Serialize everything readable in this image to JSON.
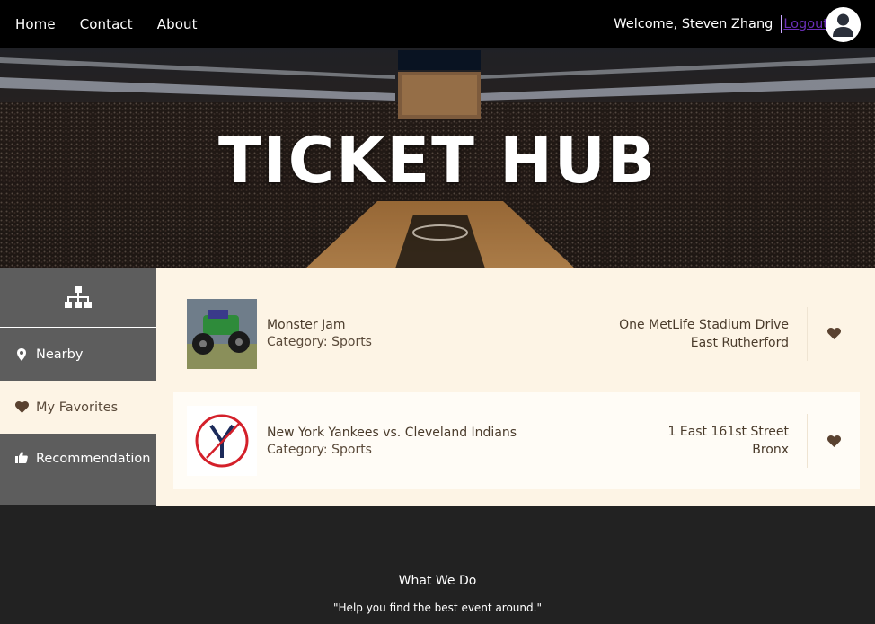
{
  "nav": {
    "links": [
      "Home",
      "Contact",
      "About"
    ],
    "welcome": "Welcome, Steven Zhang",
    "logout": "Logout"
  },
  "hero": {
    "title": "TICKET HUB"
  },
  "sidebar": {
    "items": [
      {
        "label": "Nearby",
        "icon": "map-pin-icon"
      },
      {
        "label": "My Favorites",
        "icon": "heart-icon"
      },
      {
        "label": "Recommendation",
        "icon": "thumbs-up-icon"
      }
    ]
  },
  "events": [
    {
      "name": "Monster Jam",
      "category": "Category: Sports",
      "address_line1": "One MetLife Stadium Drive",
      "address_line2": "East Rutherford"
    },
    {
      "name": "New York Yankees vs. Cleveland Indians",
      "category": "Category: Sports",
      "address_line1": "1 East 161st Street",
      "address_line2": "Bronx"
    }
  ],
  "footer": {
    "title": "What We Do",
    "text": "\"Help you find the best event around.\""
  },
  "colors": {
    "nav_bg": "#000000",
    "sidebar_bg": "#5d5d5d",
    "content_bg": "#fdf4e5",
    "heart": "#5a4230",
    "logout": "#6b2fb8",
    "footer_bg": "#222222"
  }
}
